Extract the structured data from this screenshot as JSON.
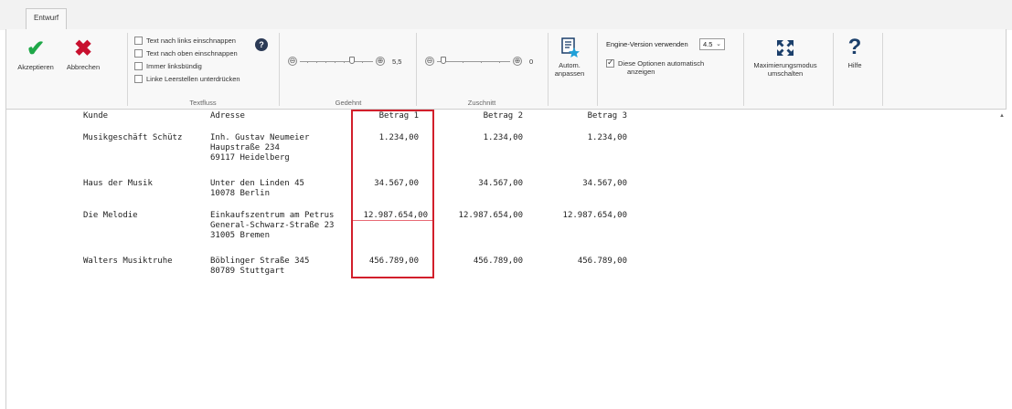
{
  "tabs": [
    {
      "label": "Entwurf"
    }
  ],
  "ribbon": {
    "accept_label": "Akzeptieren",
    "cancel_label": "Abbrechen",
    "textfluss": {
      "label": "Textfluss",
      "options": [
        {
          "label": "Text nach links einschnappen",
          "checked": false
        },
        {
          "label": "Text nach oben einschnappen",
          "checked": false
        },
        {
          "label": "Immer linksbündig",
          "checked": false
        },
        {
          "label": "Linke Leerstellen unterdrücken",
          "checked": false
        }
      ],
      "help_glyph": "?"
    },
    "gedehnt": {
      "label": "Gedehnt",
      "value": "5,5",
      "minus": "⊖",
      "plus": "⊕"
    },
    "zuschnitt": {
      "label": "Zuschnitt",
      "value": "0",
      "minus": "⊖",
      "plus": "⊕"
    },
    "auto_adjust": {
      "line1": "Autom.",
      "line2": "anpassen"
    },
    "engine": {
      "label": "Engine-Version verwenden",
      "selected": "4.5",
      "auto_option_line1": "Diese Optionen automatisch",
      "auto_option_line2": "anzeigen",
      "auto_option_checked": true
    },
    "maximize": {
      "line1": "Maximierungsmodus",
      "line2": "umschalten"
    },
    "help": {
      "label": "Hilfe"
    }
  },
  "table": {
    "headers": [
      "Kunde",
      "Adresse",
      "Betrag 1",
      "Betrag 2",
      "Betrag 3"
    ],
    "rows": [
      {
        "kunde": "Musikgeschäft Schütz",
        "adresse": [
          "Inh. Gustav Neumeier",
          "Haupstraße 234",
          "69117 Heidelberg"
        ],
        "b1": "1.234,00",
        "b2": "1.234,00",
        "b3": "1.234,00"
      },
      {
        "kunde": "Haus der Musik",
        "adresse": [
          "Unter den Linden 45",
          "10078 Berlin"
        ],
        "b1": "34.567,00",
        "b2": "34.567,00",
        "b3": "34.567,00"
      },
      {
        "kunde": "Die Melodie",
        "adresse": [
          "Einkaufszentrum am Petrus",
          "General-Schwarz-Straße 23",
          "31005 Bremen"
        ],
        "b1": "12.987.654,00",
        "b2": "12.987.654,00",
        "b3": "12.987.654,00"
      },
      {
        "kunde": "Walters Musiktruhe",
        "adresse": [
          "Böblinger Straße 345",
          "80789 Stuttgart"
        ],
        "b1": "456.789,00",
        "b2": "456.789,00",
        "b3": "456.789,00"
      }
    ]
  },
  "colors": {
    "accent_green": "#1fa848",
    "accent_red": "#c8102e",
    "highlight": "#d21f2b"
  }
}
